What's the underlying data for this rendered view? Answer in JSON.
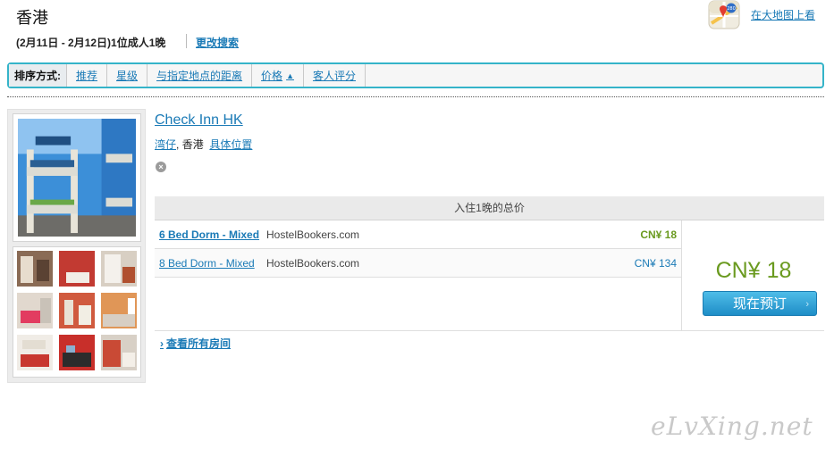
{
  "header": {
    "city": "香港",
    "search_info": "(2月11日 - 2月12日)1位成人1晚",
    "modify_search": "更改搜索",
    "map_link": "在大地图上看",
    "map_badge": "280"
  },
  "sort": {
    "label": "排序方式:",
    "items": [
      "推荐",
      "星级",
      "与指定地点的距离",
      "价格",
      "客人评分"
    ],
    "active_arrow": "▲"
  },
  "hotel": {
    "name": "Check Inn HK",
    "district": "湾仔",
    "city": "香港",
    "location_link": "具体位置",
    "close": "×"
  },
  "pricing": {
    "header": "入住1晚的总价",
    "rates": [
      {
        "room": "6 Bed Dorm - Mixed",
        "provider": "HostelBookers.com",
        "price": "CN¥ 18"
      },
      {
        "room": "8 Bed Dorm - Mixed",
        "provider": "HostelBookers.com",
        "price": "CN¥ 134"
      }
    ],
    "best_price": "CN¥ 18",
    "book_button": "现在预订",
    "book_chevron": "›",
    "all_rooms_chevron": "›",
    "all_rooms": "查看所有房间"
  },
  "watermark": "eLvXing.net",
  "colors": {
    "accent": "#35b4c9",
    "link": "#1a7ab6",
    "price_green": "#6a9a1f",
    "button": "#1e8dc7"
  }
}
